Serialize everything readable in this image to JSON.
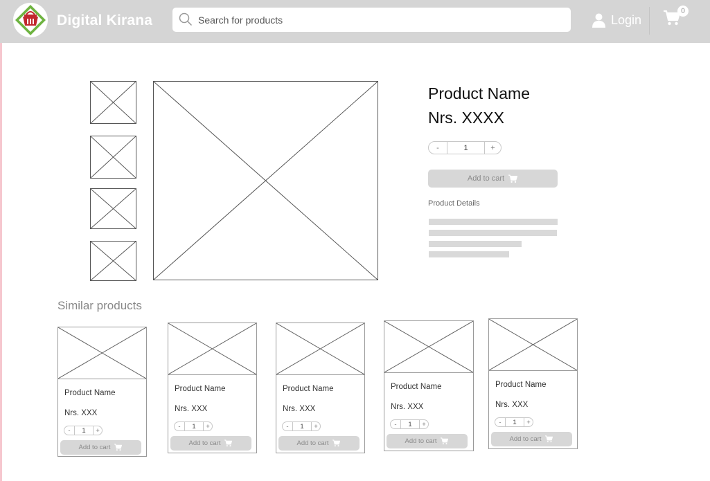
{
  "header": {
    "brand": "Digital Kirana",
    "search_placeholder": "Search for products",
    "login_label": "Login",
    "cart_count": "0",
    "icons": {
      "search": "search-icon",
      "user": "user-icon",
      "cart": "cart-icon",
      "logo": "basket-logo"
    },
    "colors": {
      "bar": "#d5d5d5",
      "logo_green": "#6db33f",
      "logo_red": "#c0272d"
    }
  },
  "product": {
    "name": "Product Name",
    "price": "Nrs. XXXX",
    "qty_minus": "-",
    "qty_value": "1",
    "qty_plus": "+",
    "add_to_cart": "Add to cart",
    "details_label": "Product Details"
  },
  "similar": {
    "title": "Similar products",
    "items": [
      {
        "name": "Product Name",
        "price": "Nrs. XXX",
        "qty_minus": "-",
        "qty_value": "1",
        "qty_plus": "+",
        "add_to_cart": "Add to cart"
      },
      {
        "name": "Product Name",
        "price": "Nrs. XXX",
        "qty_minus": "-",
        "qty_value": "1",
        "qty_plus": "+",
        "add_to_cart": "Add to cart"
      },
      {
        "name": "Product Name",
        "price": "Nrs. XXX",
        "qty_minus": "-",
        "qty_value": "1",
        "qty_plus": "+",
        "add_to_cart": "Add to cart"
      },
      {
        "name": "Product Name",
        "price": "Nrs. XXX",
        "qty_minus": "-",
        "qty_value": "1",
        "qty_plus": "+",
        "add_to_cart": "Add to cart"
      },
      {
        "name": "Product Name",
        "price": "Nrs. XXX",
        "qty_minus": "-",
        "qty_value": "1",
        "qty_plus": "+",
        "add_to_cart": "Add to cart"
      }
    ]
  }
}
